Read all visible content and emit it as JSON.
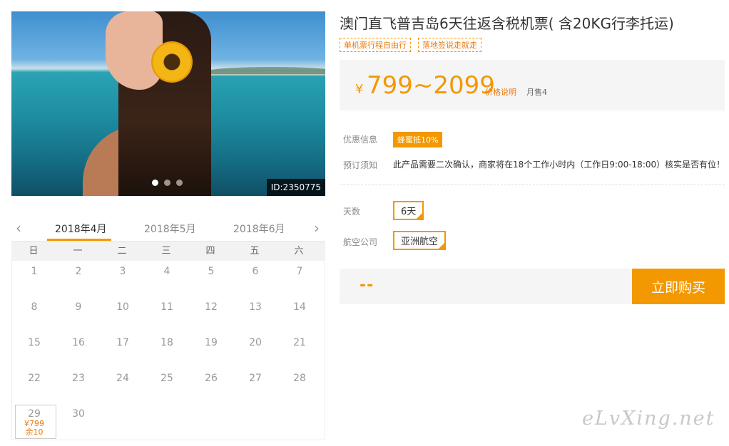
{
  "photo": {
    "product_id": "ID:2350775",
    "slide_count": 3,
    "active_slide": 1
  },
  "calendar": {
    "months": [
      "2018年4月",
      "2018年5月",
      "2018年6月"
    ],
    "active_month": "2018年4月",
    "weekdays": [
      "日",
      "一",
      "二",
      "三",
      "四",
      "五",
      "六"
    ],
    "days": [
      {
        "n": "1"
      },
      {
        "n": "2"
      },
      {
        "n": "3"
      },
      {
        "n": "4"
      },
      {
        "n": "5"
      },
      {
        "n": "6"
      },
      {
        "n": "7"
      },
      {
        "n": "8"
      },
      {
        "n": "9"
      },
      {
        "n": "10"
      },
      {
        "n": "11"
      },
      {
        "n": "12"
      },
      {
        "n": "13"
      },
      {
        "n": "14"
      },
      {
        "n": "15"
      },
      {
        "n": "16"
      },
      {
        "n": "17"
      },
      {
        "n": "18"
      },
      {
        "n": "19"
      },
      {
        "n": "20"
      },
      {
        "n": "21"
      },
      {
        "n": "22"
      },
      {
        "n": "23"
      },
      {
        "n": "24"
      },
      {
        "n": "25"
      },
      {
        "n": "26"
      },
      {
        "n": "27"
      },
      {
        "n": "28"
      },
      {
        "n": "29",
        "price": "¥799",
        "stock": "余10"
      },
      {
        "n": "30"
      }
    ]
  },
  "product": {
    "title": "澳门直飞普吉岛6天往返含税机票( 含20KG行李托运)",
    "tags": [
      "单机票行程自由行",
      "落地签说走就走"
    ]
  },
  "price": {
    "currency": "¥",
    "range": "799~2099",
    "note_link": "价格说明",
    "monthly_sales": "月售4"
  },
  "promo": {
    "label": "优惠信息",
    "badge": "蜂蜜抵10%"
  },
  "booking_notice": {
    "label": "预订须知",
    "text": "此产品需要二次确认，商家将在18个工作小时内（工作日9:00-18:00）核实是否有位！"
  },
  "options": {
    "days_label": "天数",
    "days_value": "6天",
    "airline_label": "航空公司",
    "airline_value": "亚洲航空"
  },
  "purchase": {
    "total": "--",
    "buy_label": "立即购买"
  },
  "watermark": "eLvXing.net",
  "colors": {
    "accent": "#f39800",
    "accent_text": "#e8790c"
  }
}
